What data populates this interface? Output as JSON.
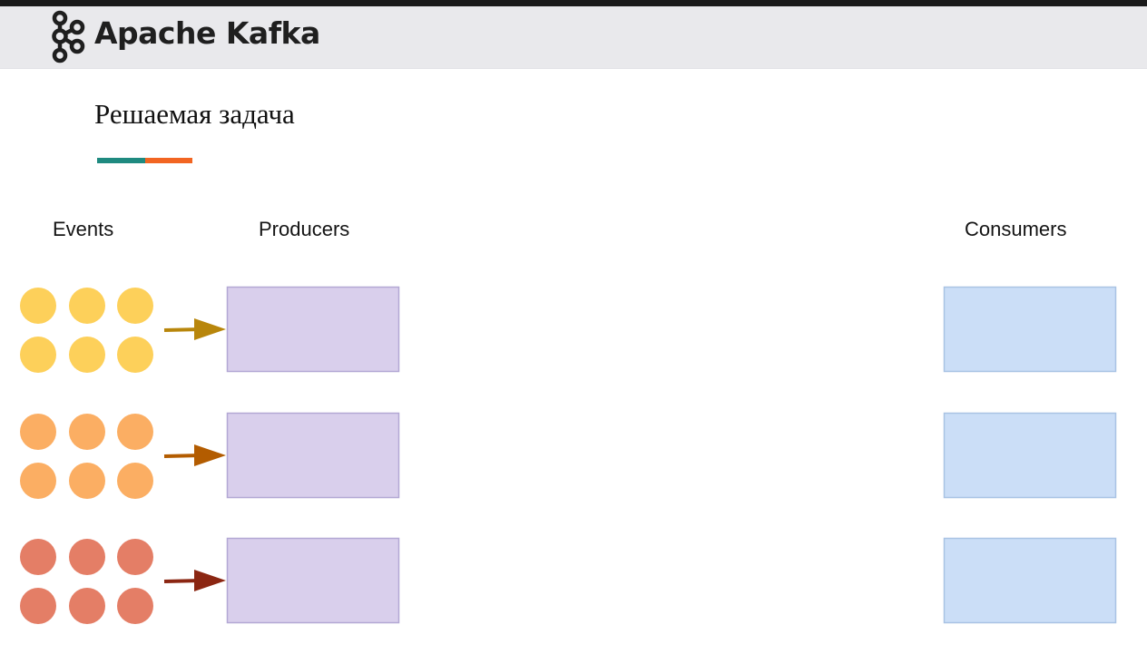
{
  "header": {
    "logo_icon": "kafka-logo-icon",
    "brand": "Apache Kafka"
  },
  "slide": {
    "title": "Решаемая задача",
    "underline_colors": [
      "#1f8a80",
      "#f26522"
    ]
  },
  "columns": {
    "events": "Events",
    "producers": "Producers",
    "consumers": "Consumers"
  },
  "rows": [
    {
      "event_color": "#fdd05a",
      "arrow_color": "#b8860b",
      "event_count": 6
    },
    {
      "event_color": "#fbae63",
      "arrow_color": "#b35c00",
      "event_count": 6
    },
    {
      "event_color": "#e47e66",
      "arrow_color": "#8b2612",
      "event_count": 6
    }
  ],
  "producer_box": {
    "fill": "#d9cfec",
    "stroke": "#b3a8d4"
  },
  "consumer_box": {
    "fill": "#cbdef7",
    "stroke": "#a9c3e4"
  }
}
